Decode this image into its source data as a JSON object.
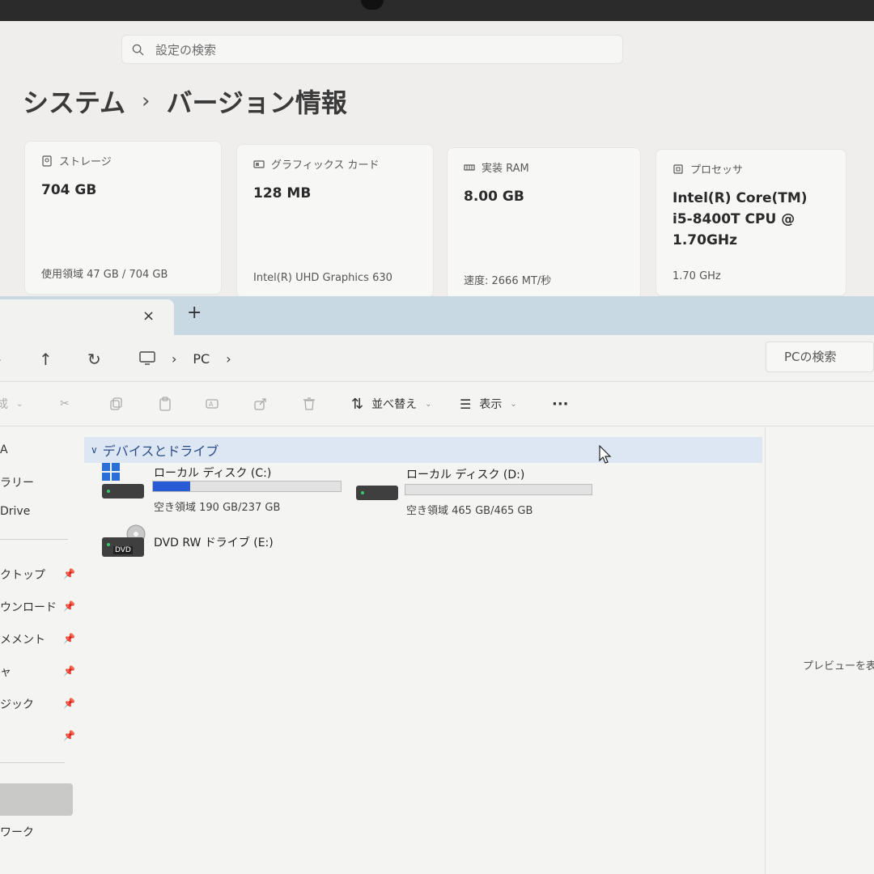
{
  "settings": {
    "search_placeholder": "設定の検索",
    "breadcrumb": {
      "parent": "システム",
      "separator": "›",
      "current": "バージョン情報"
    },
    "cards": [
      {
        "icon": "storage-icon",
        "label": "ストレージ",
        "value": "704 GB",
        "detail": "使用領域 47 GB / 704 GB"
      },
      {
        "icon": "graphics-card-icon",
        "label": "グラフィックス カード",
        "value": "128 MB",
        "detail": "Intel(R) UHD Graphics 630"
      },
      {
        "icon": "ram-icon",
        "label": "実装 RAM",
        "value": "8.00 GB",
        "detail": "速度: 2666 MT/秒"
      },
      {
        "icon": "processor-icon",
        "label": "プロセッサ",
        "value_lines": [
          "Intel(R) Core(TM)",
          "i5-8400T CPU @",
          "1.70GHz"
        ],
        "detail": "1.70 GHz"
      }
    ]
  },
  "explorer": {
    "tab": {
      "close": "×",
      "add": "+"
    },
    "nav": {
      "up": "↑",
      "refresh": "↻",
      "path": "PC",
      "sep": "›",
      "search_placeholder": "PCの検索"
    },
    "commands": {
      "new": "成",
      "sort": "並べ替え",
      "view": "表示",
      "more": "···"
    },
    "sidebar": {
      "items_top": [
        "A",
        "ラリー",
        "Drive"
      ],
      "items_pinned": [
        "クトップ",
        "ウンロード",
        "メメント",
        "ャ",
        "ジック",
        ""
      ],
      "bottom_item": "ワーク"
    },
    "group": {
      "label": "デバイスとドライブ"
    },
    "drives": [
      {
        "name": "ローカル ディスク (C:)",
        "free": "空き領域 190 GB/237 GB",
        "used_fraction": 0.2
      },
      {
        "name": "ローカル ディスク (D:)",
        "free": "空き領域 465 GB/465 GB",
        "used_fraction": 0.0
      },
      {
        "name": "DVD RW ドライブ (E:)",
        "badge": "DVD"
      }
    ],
    "preview_text": "プレビューを表示"
  },
  "colors": {
    "accent": "#2a5bd7",
    "group_bg": "#dde6f3",
    "tabbar": "#c9d9e4"
  }
}
